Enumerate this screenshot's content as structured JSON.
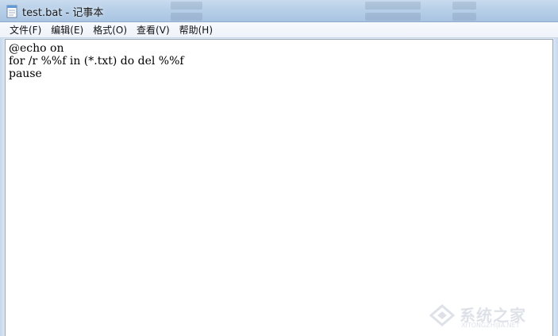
{
  "window": {
    "title": "test.bat - 记事本",
    "icon": "notepad-icon"
  },
  "menu": [
    {
      "label": "文件(F)"
    },
    {
      "label": "编辑(E)"
    },
    {
      "label": "格式(O)"
    },
    {
      "label": "查看(V)"
    },
    {
      "label": "帮助(H)"
    }
  ],
  "editor": {
    "lines": [
      "@echo on",
      "for /r %%f in (*.txt) do del %%f",
      "pause"
    ]
  },
  "watermark": {
    "text": "系统之家",
    "sub": "XITONGZHIJIA.NET",
    "icon": "watermark-logo-icon"
  }
}
